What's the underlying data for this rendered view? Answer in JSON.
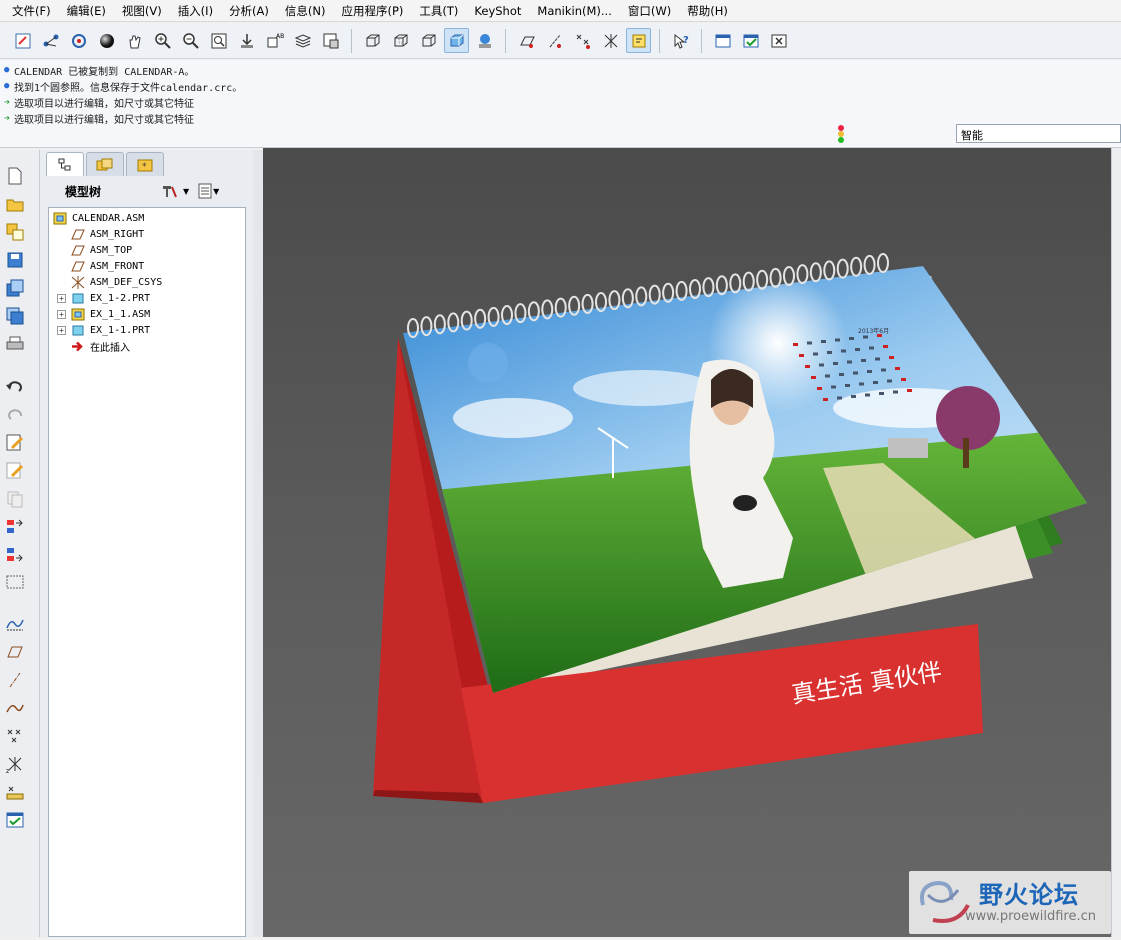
{
  "menu": [
    "文件(F)",
    "编辑(E)",
    "视图(V)",
    "插入(I)",
    "分析(A)",
    "信息(N)",
    "应用程序(P)",
    "工具(T)",
    "KeyShot",
    "Manikin(M)...",
    "窗口(W)",
    "帮助(H)"
  ],
  "messages": [
    {
      "type": "info",
      "text": "CALENDAR 已被复制到 CALENDAR-A。"
    },
    {
      "type": "info",
      "text": "找到1个圆参照。信息保存于文件calendar.crc。"
    },
    {
      "type": "prompt",
      "text": "选取项目以进行编辑，如尺寸或其它特征"
    },
    {
      "type": "prompt",
      "text": "选取项目以进行编辑，如尺寸或其它特征"
    }
  ],
  "filter": {
    "value": "智能"
  },
  "panel": {
    "title": "模型树"
  },
  "tree": [
    {
      "label": "CALENDAR.ASM",
      "icon": "assembly-icon",
      "level": 0
    },
    {
      "label": "ASM_RIGHT",
      "icon": "datum-plane-icon",
      "level": 1
    },
    {
      "label": "ASM_TOP",
      "icon": "datum-plane-icon",
      "level": 1
    },
    {
      "label": "ASM_FRONT",
      "icon": "datum-plane-icon",
      "level": 1
    },
    {
      "label": "ASM_DEF_CSYS",
      "icon": "csys-icon",
      "level": 1
    },
    {
      "label": "EX_1-2.PRT",
      "icon": "part-icon",
      "level": 1,
      "expandable": true
    },
    {
      "label": "EX_1_1.ASM",
      "icon": "subassembly-icon",
      "level": 1,
      "expandable": true
    },
    {
      "label": "EX_1-1.PRT",
      "icon": "part-icon",
      "level": 1,
      "expandable": true
    },
    {
      "label": "在此插入",
      "icon": "insert-here-arrow-icon",
      "level": 1
    }
  ],
  "model": {
    "slogan": "真生活  真伙伴",
    "calendar_title": "2013年6月"
  },
  "watermark": {
    "name": "野火论坛",
    "url": "www.proewildfire.cn"
  },
  "colors": {
    "calendar_red": "#d8312f",
    "viewport_bg": "#555555",
    "grass": "#3f9a2a",
    "sky": "#5fa6e3"
  }
}
